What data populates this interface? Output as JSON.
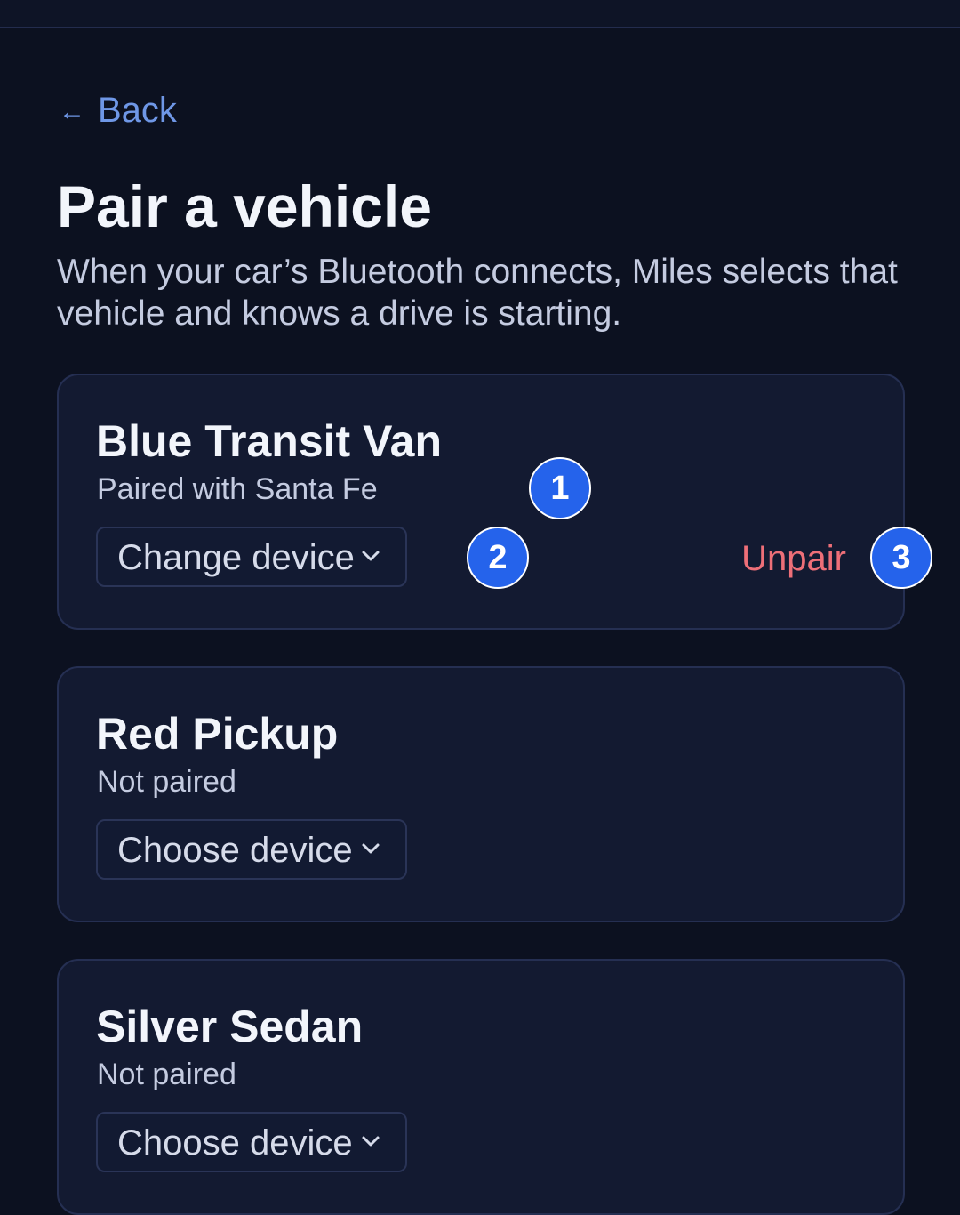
{
  "nav": {
    "back_label": "Back",
    "back_icon": "left-arrow-icon"
  },
  "header": {
    "title": "Pair a vehicle",
    "subtitle": "When your car’s Bluetooth connects, Miles selects that vehicle and knows a drive is starting."
  },
  "vehicles": [
    {
      "name": "Blue Transit Van",
      "status": "Paired with Santa Fe",
      "device_button": "Change device",
      "unpair_label": "Unpair"
    },
    {
      "name": "Red Pickup",
      "status": "Not paired",
      "device_button": "Choose device"
    },
    {
      "name": "Silver Sedan",
      "status": "Not paired",
      "device_button": "Choose device"
    }
  ],
  "markers": [
    "1",
    "2",
    "3"
  ],
  "colors": {
    "background": "#0c1120",
    "card": "#131a31",
    "link": "#6f97e6",
    "danger": "#ee6f78",
    "marker": "#2563eb"
  }
}
